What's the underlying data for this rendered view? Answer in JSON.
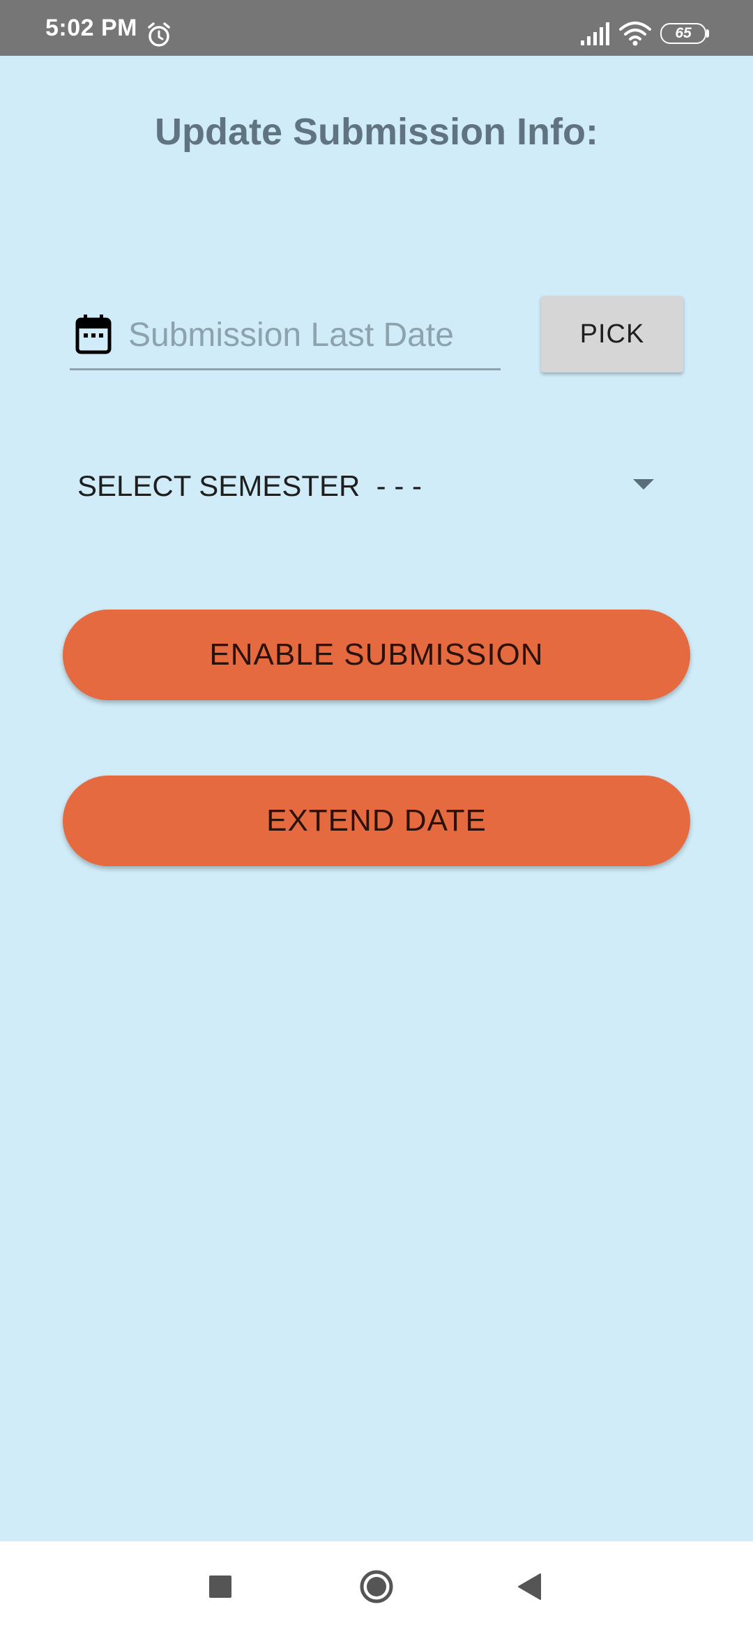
{
  "status_bar": {
    "time": "5:02 PM",
    "battery_level": "65",
    "icons": [
      "alarm-icon",
      "signal-icon",
      "wifi-icon",
      "battery-icon"
    ]
  },
  "page": {
    "title": "Update Submission Info:"
  },
  "date_field": {
    "icon": "calendar-icon",
    "placeholder": "Submission Last Date",
    "value": ""
  },
  "pick_button": {
    "label": "PICK"
  },
  "semester_dropdown": {
    "selected": "SELECT SEMESTER  - - -",
    "icon": "dropdown-arrow-icon"
  },
  "actions": {
    "enable_label": "ENABLE SUBMISSION",
    "extend_label": "EXTEND DATE"
  },
  "nav_bar": {
    "icons": [
      "recents-icon",
      "home-icon",
      "back-icon"
    ]
  },
  "colors": {
    "background": "#D0ECF8",
    "status_bar": "#767676",
    "title": "#5F7380",
    "accent_button": "#E66A3F",
    "pick_button": "#D6D6D6",
    "nav_bar": "#FFFFFF"
  }
}
